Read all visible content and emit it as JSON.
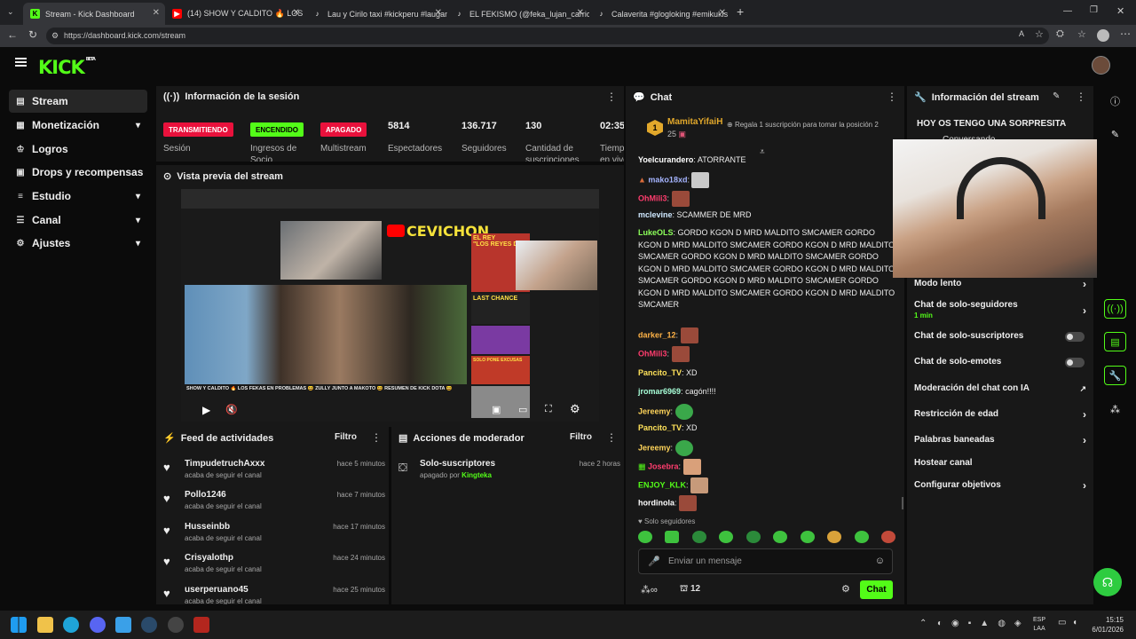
{
  "browser": {
    "tabs": [
      {
        "title": "Stream - Kick Dashboard"
      },
      {
        "title": "(14) SHOW Y CALDITO 🔥 LOS"
      },
      {
        "title": "Lau y Cirilo taxi #kickperu #laugam"
      },
      {
        "title": "EL FEKISMO (@feka_lujan_carrion)"
      },
      {
        "title": "Calaverita #glogloking #emikukis"
      }
    ],
    "url": "https://dashboard.kick.com/stream"
  },
  "brand": {
    "logo": "KICK",
    "beta": "BETA"
  },
  "sidebar": {
    "items": [
      {
        "label": "Stream",
        "icon": "stream-icon",
        "active": true
      },
      {
        "label": "Monetización",
        "icon": "dollar-icon",
        "expandable": true
      },
      {
        "label": "Logros",
        "icon": "trophy-icon"
      },
      {
        "label": "Drops y recompensas",
        "icon": "drops-icon"
      },
      {
        "label": "Estudio",
        "icon": "studio-icon",
        "expandable": true
      },
      {
        "label": "Canal",
        "icon": "channel-icon",
        "expandable": true
      },
      {
        "label": "Ajustes",
        "icon": "gear-icon",
        "expandable": true
      }
    ]
  },
  "session": {
    "title": "Información de la sesión",
    "badges": [
      {
        "label": "TRANSMITIENDO",
        "caption": "Sesión",
        "color": "#e9113c"
      },
      {
        "label": "ENCENDIDO",
        "caption": "Ingresos de Socio",
        "color": "#53fc18"
      },
      {
        "label": "APAGADO",
        "caption": "Multistream",
        "color": "#e9113c"
      }
    ],
    "stats": [
      {
        "value": "5814",
        "label": "Espectadores"
      },
      {
        "value": "136.717",
        "label": "Seguidores"
      },
      {
        "value": "130",
        "label": "Cantidad de suscripciones"
      },
      {
        "value": "02:35",
        "label": "Tiempo en vivo"
      }
    ]
  },
  "preview": {
    "title": "Vista previa del stream",
    "video_title": "CEVICHON",
    "video_caption": "SHOW Y CALDITO 🔥 LOS FEKAS EN PROBLEMAS 😆 ZULLY JUNTO A MAKOTO 😆 RESUMEN DE KICK DOTA 😆",
    "side_labels": [
      "EL REY",
      "\"LOS REYES DE",
      "LAST CHANCE",
      "SOLO PONE EXCUSAS"
    ]
  },
  "feed": {
    "title": "Feed de actividades",
    "filter": "Filtro",
    "items": [
      {
        "name": "TimpudetruchAxxx",
        "sub": "acaba de seguir el canal",
        "time": "hace 5 minutos"
      },
      {
        "name": "Pollo1246",
        "sub": "acaba de seguir el canal",
        "time": "hace 7 minutos"
      },
      {
        "name": "Husseinbb",
        "sub": "acaba de seguir el canal",
        "time": "hace 17 minutos"
      },
      {
        "name": "Crisyalothp",
        "sub": "acaba de seguir el canal",
        "time": "hace 24 minutos"
      },
      {
        "name": "userperuano45",
        "sub": "acaba de seguir el canal",
        "time": "hace 25 minutos"
      }
    ]
  },
  "mod": {
    "title": "Acciones de moderador",
    "filter": "Filtro",
    "items": [
      {
        "name": "Solo-suscriptores",
        "sub_prefix": "apagado por",
        "sub_user": "Kingteka",
        "time": "hace 2 horas"
      }
    ]
  },
  "chat": {
    "title": "Chat",
    "top_user": "MamitaYifaiH",
    "top_rank": "1",
    "top_count": "25",
    "gift_text": "Regala 1 suscripción para tomar la posición 2",
    "messages": [
      {
        "user": "Yoelcurandero",
        "color": "#ffffff",
        "text": "ATORRANTE"
      },
      {
        "user": "mako18xd",
        "color": "#a5b4ff",
        "text": ""
      },
      {
        "user": "OhMili3",
        "color": "#ff3d6e",
        "text": ""
      },
      {
        "user": "mclevine",
        "color": "#cfe8ff",
        "text": "SCAMMER DE MRD"
      },
      {
        "user": "LukeOLS",
        "color": "#8cff5a",
        "text": "GORDO KGON D MRD MALDITO SMCAMER GORDO KGON D MRD MALDITO SMCAMER GORDO KGON D MRD MALDITO SMCAMER GORDO KGON D MRD MALDITO SMCAMER GORDO KGON D MRD MALDITO SMCAMER GORDO KGON D MRD MALDITO SMCAMER GORDO KGON D MRD MALDITO SMCAMER GORDO KGON D MRD MALDITO SMCAMER GORDO KGON D MRD MALDITO SMCAMER"
      },
      {
        "user": "darker_12",
        "color": "#ffb347",
        "text": ""
      },
      {
        "user": "OhMili3",
        "color": "#ff3d6e",
        "text": ""
      },
      {
        "user": "Pancito_TV",
        "color": "#ffe25a",
        "text": "XD"
      },
      {
        "user": "jromar6969",
        "color": "#a8ffd8",
        "text": "cagón!!!!"
      },
      {
        "user": "Jereemy",
        "color": "#ffd45a",
        "text": ""
      },
      {
        "user": "Pancito_TV",
        "color": "#ffe25a",
        "text": "XD"
      },
      {
        "user": "Jereemy",
        "color": "#ffd45a",
        "text": ""
      },
      {
        "user": "Josebra",
        "color": "#ff3d6e",
        "text": ""
      },
      {
        "user": "ENJOY_KLK",
        "color": "#53fc18",
        "text": ""
      },
      {
        "user": "hordinola",
        "color": "#ffffff",
        "text": ""
      }
    ],
    "mode_note": "Solo seguidores",
    "input_placeholder": "Enviar un mensaje",
    "points": "12",
    "send_label": "Chat"
  },
  "stream_info": {
    "title": "Información del stream",
    "stream_title": "HOY OS TENGO UNA SORPRESITA",
    "category": "Conversando",
    "settings": [
      {
        "label": "Modo lento",
        "control": "chevron"
      },
      {
        "label": "Chat de solo-seguidores",
        "sub": "1 min",
        "control": "chevron"
      },
      {
        "label": "Chat de solo-suscriptores",
        "control": "toggle"
      },
      {
        "label": "Chat de solo-emotes",
        "control": "toggle"
      },
      {
        "label": "Moderación del chat con IA",
        "control": "external"
      },
      {
        "label": "Restricción de edad",
        "control": "chevron"
      },
      {
        "label": "Palabras baneadas",
        "control": "chevron"
      },
      {
        "label": "Hostear canal",
        "control": "none"
      },
      {
        "label": "Configurar objetivos",
        "control": "chevron"
      }
    ]
  },
  "taskbar": {
    "lang": "ESP",
    "region": "LAA",
    "time": "15:15",
    "date": "6/01/2026"
  },
  "colors": {
    "accent": "#53fc18",
    "live": "#e9113c",
    "panel": "#181818"
  }
}
